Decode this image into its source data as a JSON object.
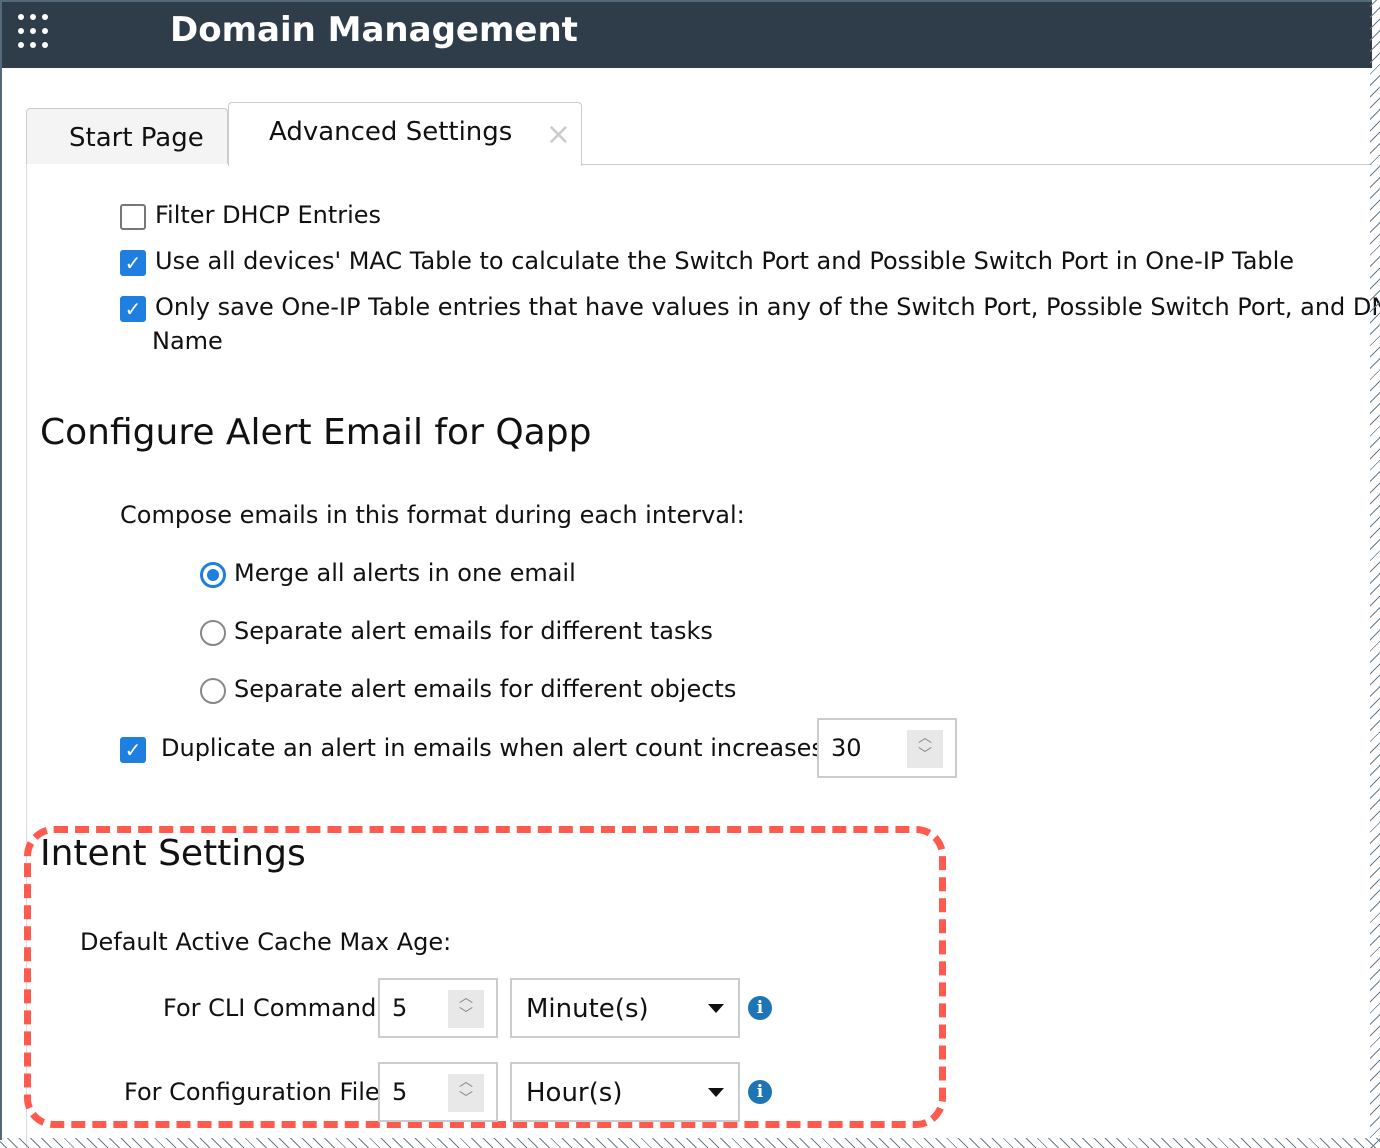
{
  "header": {
    "title": "Domain Management"
  },
  "tabs": [
    {
      "label": "Start Page"
    },
    {
      "label": "Advanced Settings",
      "close": "×"
    }
  ],
  "options": [
    {
      "label": "Filter DHCP Entries",
      "checked": false
    },
    {
      "label": "Use all devices' MAC Table to calculate the Switch Port and Possible Switch Port in One-IP Table",
      "checked": true
    },
    {
      "label": "Only save One-IP Table entries that have values in any of the Switch Port, Possible Switch Port, and DNS",
      "label_cont": "Name",
      "checked": true
    }
  ],
  "alert": {
    "title": "Configure Alert Email for Qapp",
    "compose_label": "Compose emails in this format during each interval:",
    "radios": [
      {
        "label": "Merge all alerts in one email",
        "selected": true
      },
      {
        "label": "Separate alert emails for different tasks",
        "selected": false
      },
      {
        "label": "Separate alert emails for different objects",
        "selected": false
      }
    ],
    "duplicate_label": "Duplicate an alert in emails when alert count increases by",
    "duplicate_checked": true,
    "duplicate_value": "30"
  },
  "intent": {
    "title": "Intent Settings",
    "cache_label": "Default Active Cache Max Age:",
    "cli": {
      "label": "For CLI Command:",
      "value": "5",
      "unit": "Minute(s)"
    },
    "config": {
      "label": "For Configuration File:",
      "value": "5",
      "unit": "Hour(s)"
    }
  },
  "colors": {
    "header": "#2f3d4a",
    "accent": "#1e7fe0",
    "highlight": "#ff5a4e"
  }
}
